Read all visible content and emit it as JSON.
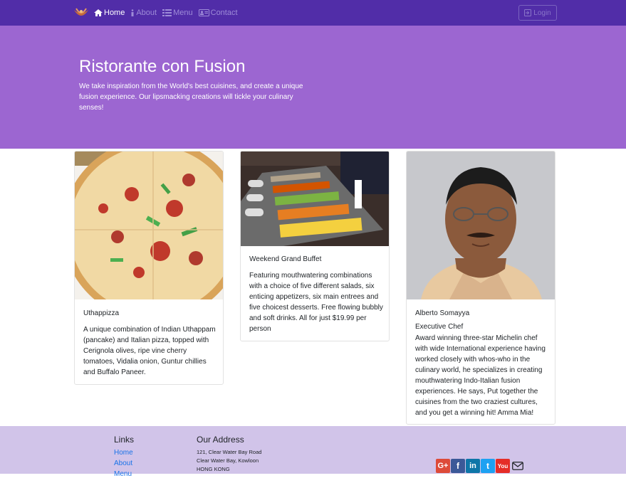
{
  "nav": {
    "items": [
      {
        "label": "Home",
        "icon": "home-icon",
        "active": true
      },
      {
        "label": "About",
        "icon": "info-icon",
        "active": false
      },
      {
        "label": "Menu",
        "icon": "list-icon",
        "active": false
      },
      {
        "label": "Contact",
        "icon": "address-card-icon",
        "active": false
      }
    ],
    "login_label": "Login"
  },
  "jumbotron": {
    "title": "Ristorante con Fusion",
    "text": "We take inspiration from the World's best cuisines, and create a unique fusion experience. Our lipsmacking creations will tickle your culinary senses!"
  },
  "cards": [
    {
      "title": "Uthappizza",
      "text": "A unique combination of Indian Uthappam (pancake) and Italian pizza, topped with Cerignola olives, ripe vine cherry tomatoes, Vidalia onion, Guntur chillies and Buffalo Paneer."
    },
    {
      "title": "Weekend Grand Buffet",
      "text": "Featuring mouthwatering combinations with a choice of five different salads, six enticing appetizers, six main entrees and five choicest desserts. Free flowing bubbly and soft drinks. All for just $19.99 per person"
    },
    {
      "title": "Alberto Somayya",
      "subtitle": "Executive Chef",
      "text": "Award winning three-star Michelin chef with wide International experience having worked closely with whos-who in the culinary world, he specializes in creating mouthwatering Indo-Italian fusion experiences. He says, Put together the cuisines from the two craziest cultures, and you get a winning hit! Amma Mia!"
    }
  ],
  "footer": {
    "links_heading": "Links",
    "links": [
      "Home",
      "About",
      "Menu"
    ],
    "address_heading": "Our Address",
    "address_lines": [
      "121, Clear Water Bay Road",
      "Clear Water Bay, Kowloon",
      "HONG KONG"
    ],
    "social": [
      {
        "name": "google-plus-icon",
        "label": "G+",
        "color": "#dd4b39"
      },
      {
        "name": "facebook-icon",
        "label": "f",
        "color": "#3b5998"
      },
      {
        "name": "linkedin-icon",
        "label": "in",
        "color": "#0e76a8"
      },
      {
        "name": "twitter-icon",
        "label": "t",
        "color": "#1da1f2"
      },
      {
        "name": "youtube-icon",
        "label": "You",
        "color": "#e52d27"
      },
      {
        "name": "mail-icon",
        "label": "",
        "color": "#212529"
      }
    ]
  },
  "colors": {
    "navbar": "#512da8",
    "jumbotron": "#9c66d1",
    "footer": "#d1c4e9"
  }
}
